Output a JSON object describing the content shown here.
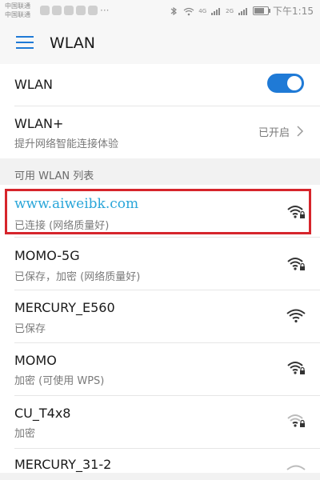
{
  "status_bar": {
    "carrier_1": "中国联通",
    "carrier_2": "中国联通",
    "time": "下午1:15",
    "net_4g": "4G",
    "net_2g": "2G"
  },
  "app_bar": {
    "title": "WLAN"
  },
  "wlan_switch": {
    "label": "WLAN",
    "state": "on"
  },
  "wlan_plus": {
    "title": "WLAN+",
    "subtitle": "提升网络智能连接体验",
    "status": "已开启"
  },
  "section_header": "可用 WLAN 列表",
  "networks": [
    {
      "name": "www.aiweibk.com",
      "status": "已连接 (网络质量好)",
      "locked": true
    },
    {
      "name": "MOMO-5G",
      "status": "已保存，加密 (网络质量好)",
      "locked": true
    },
    {
      "name": "MERCURY_E560",
      "status": "已保存",
      "locked": false
    },
    {
      "name": "MOMO",
      "status": "加密 (可使用 WPS)",
      "locked": true
    },
    {
      "name": "CU_T4x8",
      "status": "加密",
      "locked": true
    },
    {
      "name": "MERCURY_31-2",
      "status": "",
      "locked": false
    }
  ],
  "colors": {
    "accent": "#1f7ad6",
    "highlight_border": "#d6252c",
    "connected_text": "#2aa6d9"
  }
}
